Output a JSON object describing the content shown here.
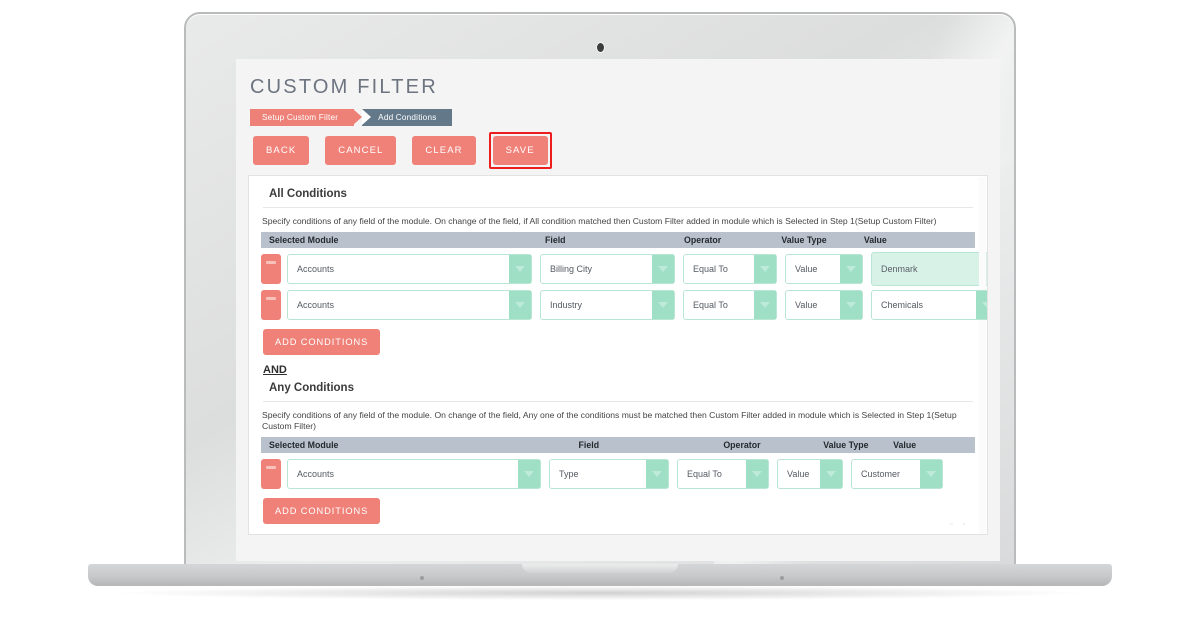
{
  "page": {
    "title": "CUSTOM FILTER"
  },
  "steps": [
    {
      "label": "Setup Custom Filter",
      "state": "done"
    },
    {
      "label": "Add Conditions",
      "state": "current"
    }
  ],
  "actions": [
    {
      "label": "BACK",
      "name": "back-button",
      "highlighted": false
    },
    {
      "label": "CANCEL",
      "name": "cancel-button",
      "highlighted": false
    },
    {
      "label": "CLEAR",
      "name": "clear-button",
      "highlighted": false
    },
    {
      "label": "SAVE",
      "name": "save-button",
      "highlighted": true
    }
  ],
  "all_conditions": {
    "title": "All Conditions",
    "hint": "Specify conditions of any field of the module. On change of the field, if All condition matched then Custom Filter added in module which is Selected in Step 1(Setup Custom Filter)",
    "columns": [
      "Selected Module",
      "Field",
      "Operator",
      "Value Type",
      "Value"
    ],
    "rows": [
      {
        "selected_module": "Accounts",
        "field": "Billing City",
        "operator": "Equal To",
        "value_type": "Value",
        "value": "Denmark",
        "value_is_textbox": true
      },
      {
        "selected_module": "Accounts",
        "field": "Industry",
        "operator": "Equal To",
        "value_type": "Value",
        "value": "Chemicals",
        "value_is_textbox": false
      }
    ],
    "add_label": "ADD CONDITIONS"
  },
  "conjunction": "AND",
  "any_conditions": {
    "title": "Any Conditions",
    "hint": "Specify conditions of any field of the module. On change of the field, Any one of the conditions must be matched then Custom Filter added in module which is Selected in Step 1(Setup Custom Filter)",
    "columns": [
      "Selected Module",
      "Field",
      "Operator",
      "Value Type",
      "Value"
    ],
    "rows": [
      {
        "selected_module": "Accounts",
        "field": "Type",
        "operator": "Equal To",
        "value_type": "Value",
        "value": "Customer",
        "value_is_textbox": false
      }
    ],
    "add_label": "ADD CONDITIONS"
  },
  "colors": {
    "accent_red": "#ef8178",
    "step_current": "#63798a",
    "table_header": "#b9c2cc",
    "select_green": "#9fdfc6",
    "textbox_green": "#d8f2e8",
    "highlight_border": "#ee1d1d"
  }
}
